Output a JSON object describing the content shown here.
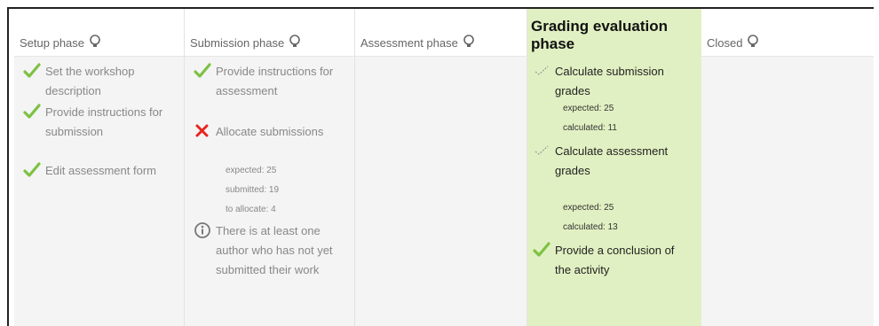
{
  "phases": [
    {
      "title": "Setup phase",
      "tasks": [
        {
          "status": "done",
          "icon": "check-icon",
          "text": "Set the workshop description"
        },
        {
          "status": "done",
          "icon": "check-icon",
          "text": "Provide instructions for submission"
        },
        {
          "status": "done",
          "icon": "check-icon",
          "text": "Edit assessment form"
        }
      ]
    },
    {
      "title": "Submission phase",
      "tasks": [
        {
          "status": "done",
          "icon": "check-icon",
          "text": "Provide instructions for assessment"
        },
        {
          "status": "fail",
          "icon": "cross-icon",
          "text": "Allocate submissions",
          "details": [
            "expected: 25",
            "submitted: 19",
            "to allocate: 4"
          ]
        },
        {
          "status": "info",
          "icon": "info-icon",
          "text": "There is at least one author who has not yet submitted their work"
        }
      ]
    },
    {
      "title": "Assessment phase",
      "tasks": []
    },
    {
      "title": "Grading evaluation phase",
      "active": true,
      "tasks": [
        {
          "status": "todo",
          "icon": "todo-check-icon",
          "text": "Calculate submission grades",
          "details": [
            "expected: 25",
            "calculated: 11"
          ]
        },
        {
          "status": "todo",
          "icon": "todo-check-icon",
          "text": "Calculate assessment grades",
          "details": [
            "expected: 25",
            "calculated: 13"
          ]
        },
        {
          "status": "done",
          "icon": "check-icon",
          "text": "Provide a conclusion of the activity"
        }
      ]
    },
    {
      "title": "Closed",
      "tasks": []
    }
  ],
  "colors": {
    "check": "#7cc242",
    "cross": "#e8251e",
    "active_bg": "#e1f0c2",
    "cell_bg": "#f4f4f4",
    "muted_text": "#888888"
  }
}
